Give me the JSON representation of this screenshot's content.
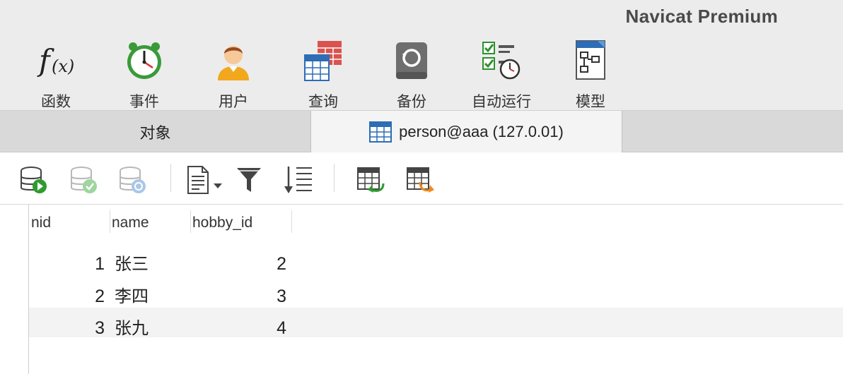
{
  "app": {
    "title": "Navicat Premium"
  },
  "toolbar": {
    "items": [
      {
        "label": "函数",
        "icon": "function-icon"
      },
      {
        "label": "事件",
        "icon": "alarm-clock-icon"
      },
      {
        "label": "用户",
        "icon": "user-icon"
      },
      {
        "label": "查询",
        "icon": "query-icon"
      },
      {
        "label": "备份",
        "icon": "backup-icon"
      },
      {
        "label": "自动运行",
        "icon": "automation-icon"
      },
      {
        "label": "模型",
        "icon": "model-icon"
      }
    ]
  },
  "tabs": {
    "objects_label": "对象",
    "table_label": "person@aaa (127.0.01)"
  },
  "subtoolbar": {
    "buttons": [
      "begin-transaction-icon",
      "commit-icon",
      "rollback-icon",
      "text-view-icon",
      "filter-icon",
      "sort-icon",
      "import-icon",
      "export-icon"
    ]
  },
  "grid": {
    "columns": [
      "nid",
      "name",
      "hobby_id"
    ],
    "rows": [
      {
        "nid": "1",
        "name": "张三",
        "hobby_id": "2"
      },
      {
        "nid": "2",
        "name": "李四",
        "hobby_id": "3"
      },
      {
        "nid": "3",
        "name": "张九",
        "hobby_id": "4"
      }
    ]
  },
  "colors": {
    "toolbar_bg": "#ececec",
    "tab_bar_bg": "#d9d9d9",
    "active_tab_bg": "#f4f4f4",
    "alt_row_bg": "#f3f3f3"
  }
}
